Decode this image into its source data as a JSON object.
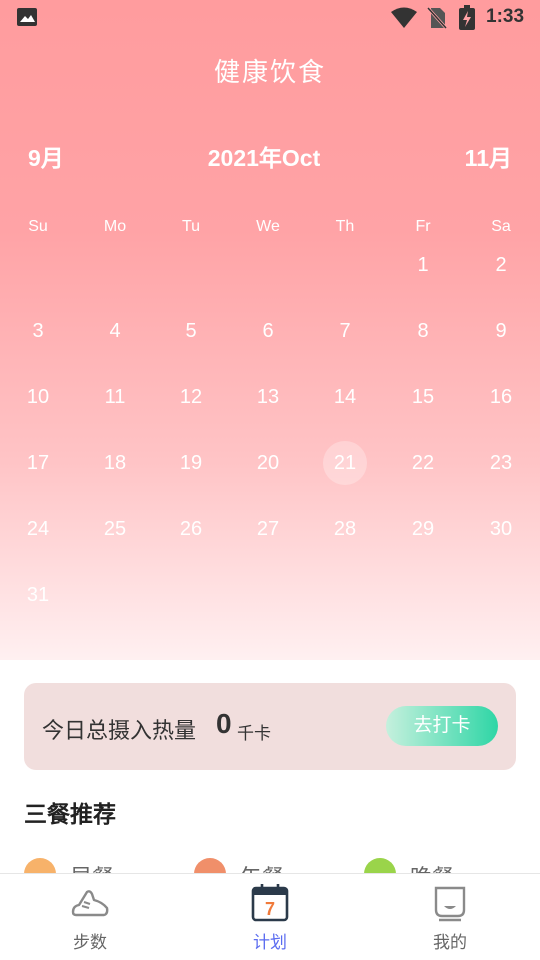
{
  "status_bar": {
    "time": "1:33"
  },
  "app": {
    "title": "健康饮食"
  },
  "calendar": {
    "prev_label": "9月",
    "current_label": "2021年Oct",
    "next_label": "11月",
    "weekdays": [
      "Su",
      "Mo",
      "Tu",
      "We",
      "Th",
      "Fr",
      "Sa"
    ],
    "days": [
      "1",
      "2",
      "3",
      "4",
      "5",
      "6",
      "7",
      "8",
      "9",
      "10",
      "11",
      "12",
      "13",
      "14",
      "15",
      "16",
      "17",
      "18",
      "19",
      "20",
      "21",
      "22",
      "23",
      "24",
      "25",
      "26",
      "27",
      "28",
      "29",
      "30",
      "31"
    ],
    "first_weekday_index": 5,
    "selected_day": "21"
  },
  "intake": {
    "label": "今日总摄入热量",
    "value": "0",
    "unit": "千卡",
    "button_label": "去打卡"
  },
  "meals": {
    "title": "三餐推荐",
    "items": [
      {
        "label": "早餐",
        "color": "#f7b26a"
      },
      {
        "label": "午餐",
        "color": "#f08f6a"
      },
      {
        "label": "晚餐",
        "color": "#9ad44a"
      }
    ]
  },
  "tabs": [
    {
      "label": "步数",
      "icon": "sneaker-icon"
    },
    {
      "label": "计划",
      "icon": "calendar-icon",
      "active": true,
      "badge": "7"
    },
    {
      "label": "我的",
      "icon": "profile-icon"
    }
  ],
  "colors": {
    "header_top": "#ff9c9e",
    "accent_tab": "#5b6cf0",
    "button_green": "#2fd6a6"
  }
}
